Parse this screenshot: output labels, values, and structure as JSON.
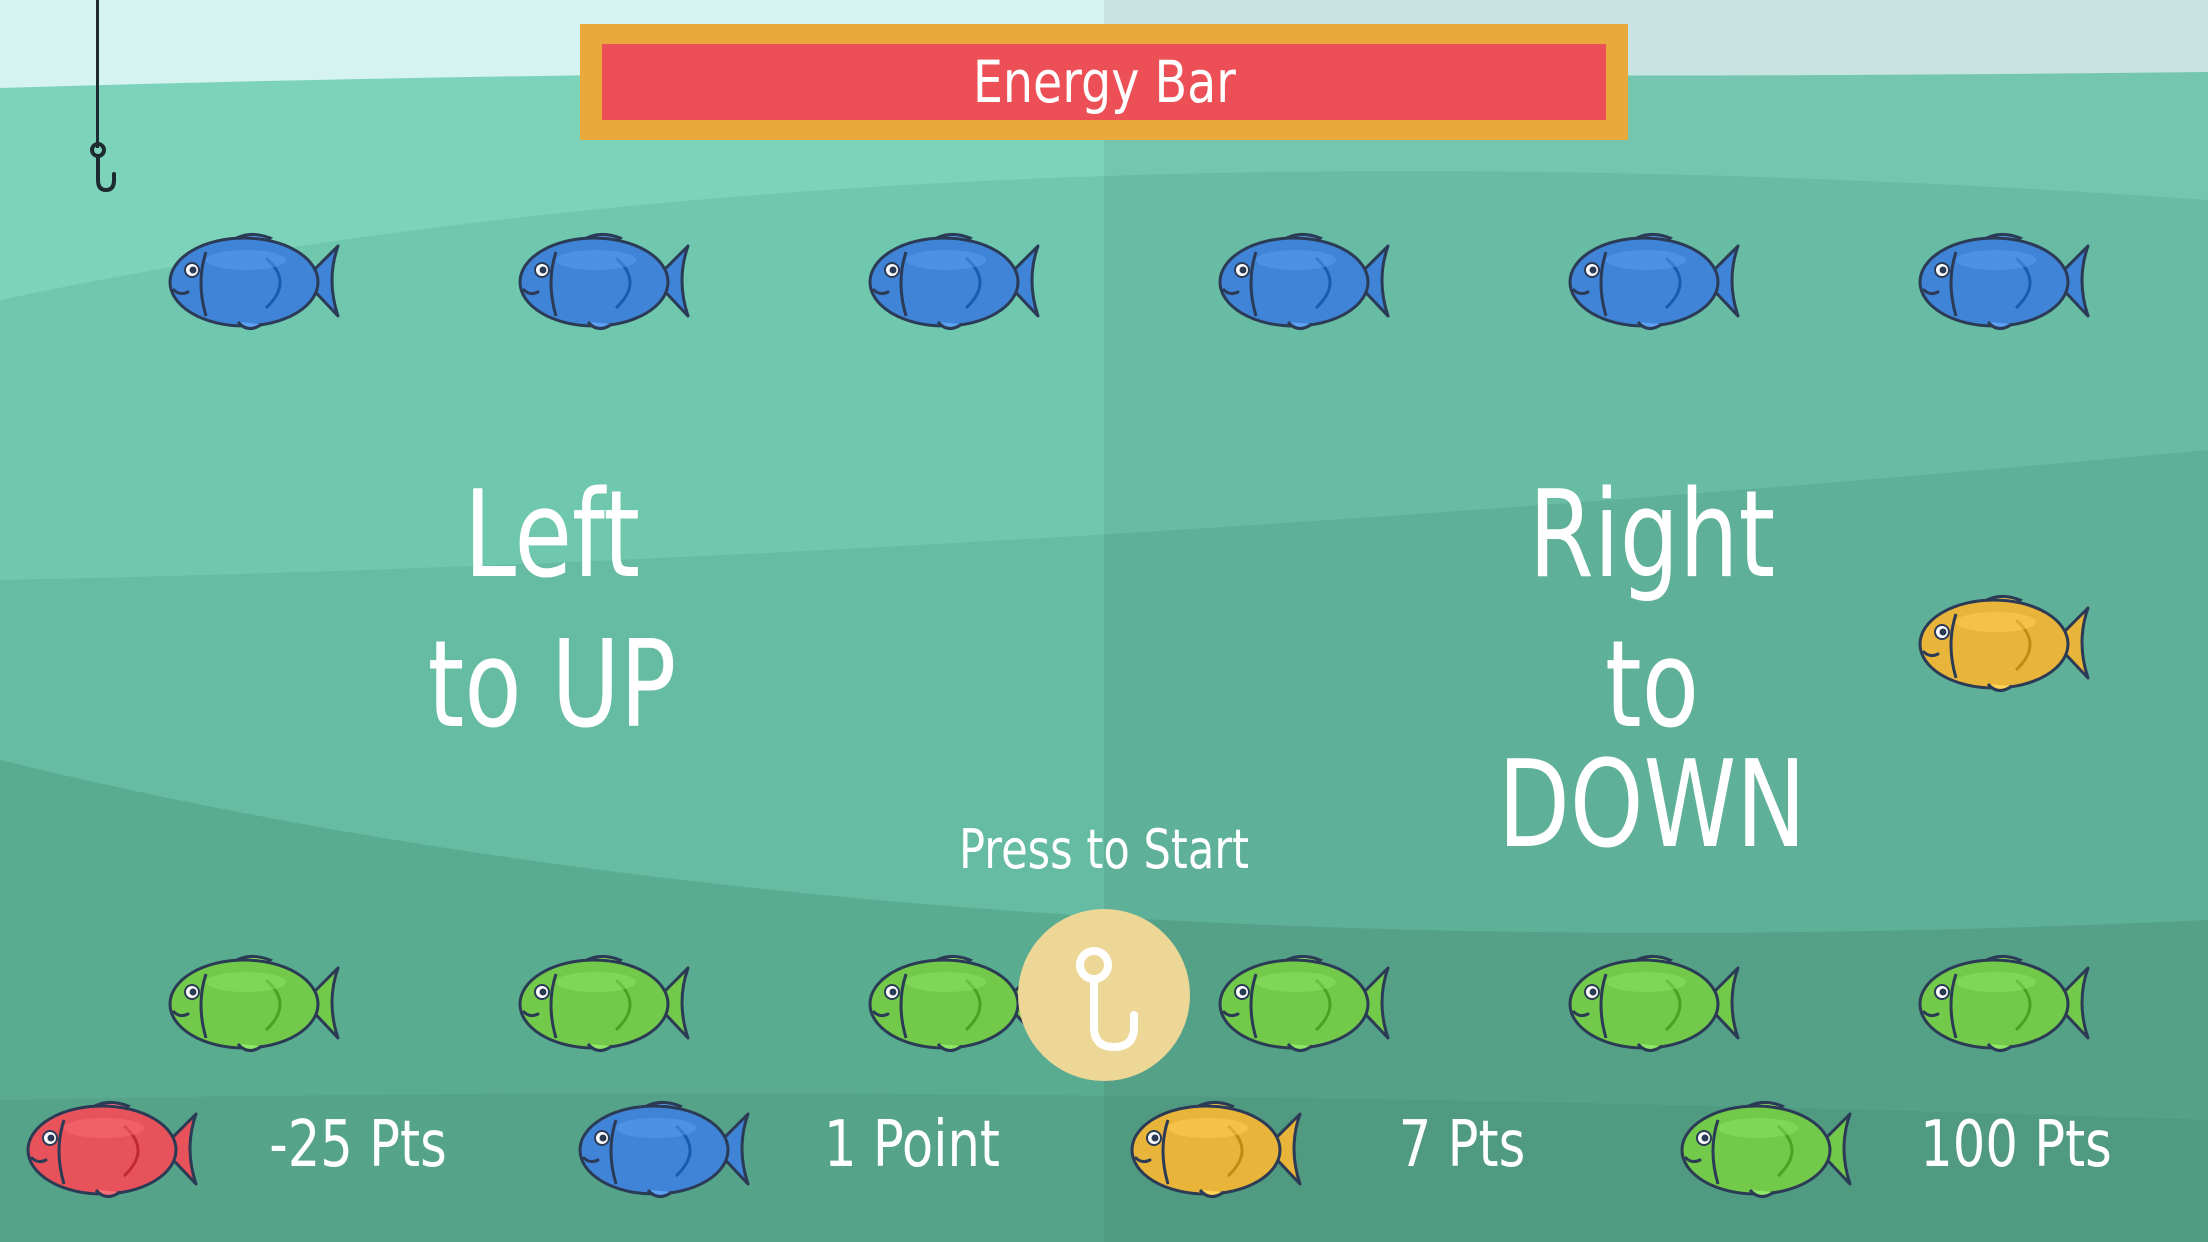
{
  "energy_bar": {
    "label": "Energy Bar",
    "level_percent": 100,
    "fill_color": "#ec4f56",
    "frame_color": "#e9a93c"
  },
  "instructions": {
    "left_line1": "Left",
    "left_line2": "to UP",
    "right_line1": "Right",
    "right_line2": "to DOWN"
  },
  "start": {
    "label": "Press to Start",
    "icon": "hook-icon"
  },
  "fish_rows": {
    "top": [
      "blue",
      "blue",
      "blue",
      "blue",
      "blue",
      "blue"
    ],
    "middle_right": [
      "yellow"
    ],
    "bottom": [
      "green",
      "green",
      "green",
      "green",
      "green",
      "green"
    ]
  },
  "legend": [
    {
      "fish": "red",
      "label": "-25 Pts"
    },
    {
      "fish": "blue",
      "label": "1 Point"
    },
    {
      "fish": "yellow",
      "label": "7 Pts"
    },
    {
      "fish": "green",
      "label": "100 Pts"
    }
  ],
  "colors": {
    "blue": "#3f84d6",
    "green": "#72c94a",
    "yellow": "#e9b43a",
    "red": "#e8525a",
    "sky": "#d4f3f1",
    "water_1": "#7dd3b9",
    "water_2": "#69c4aa",
    "water_3": "#5fb399",
    "water_4": "#58a88d"
  }
}
